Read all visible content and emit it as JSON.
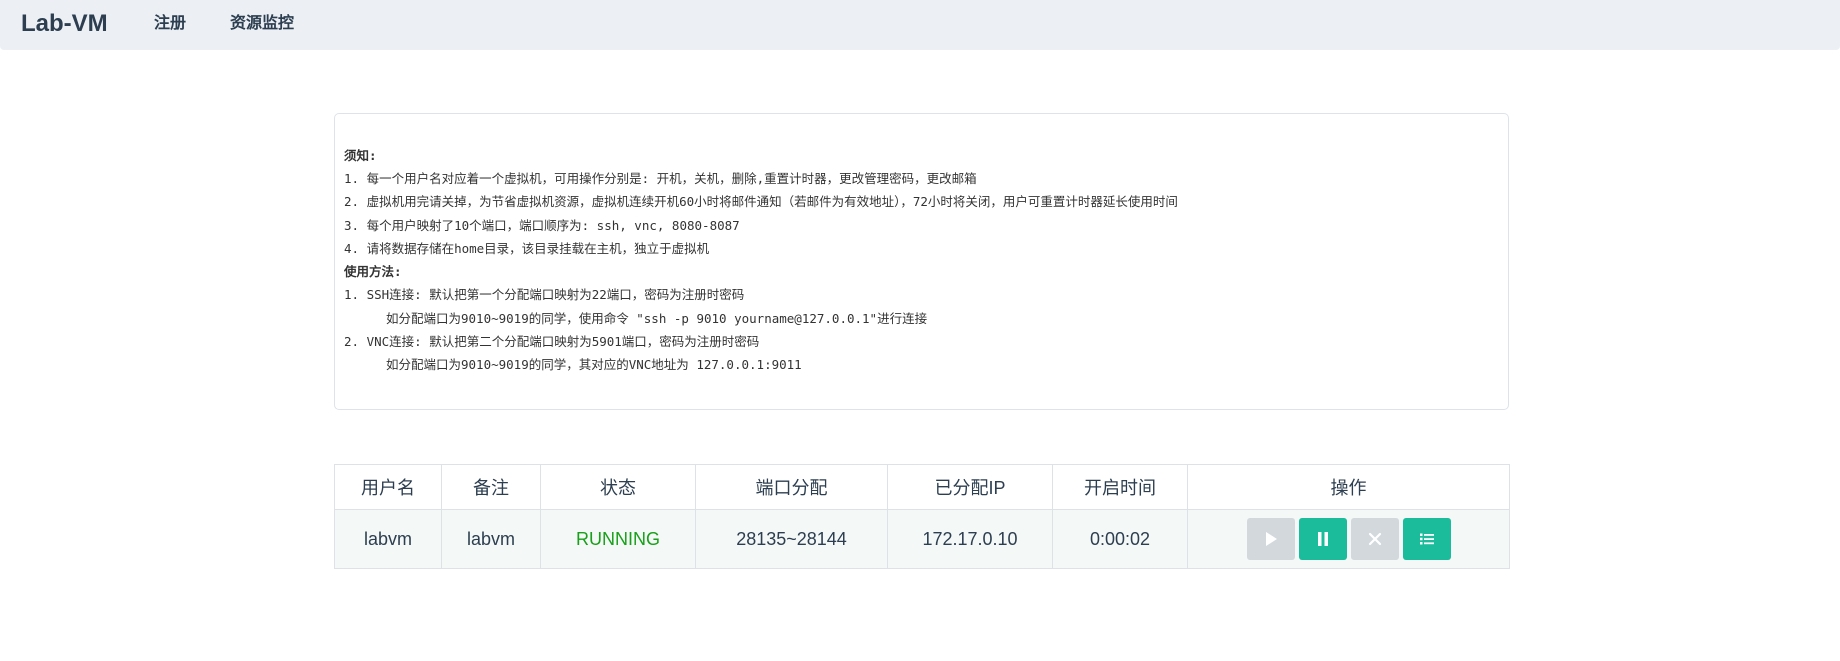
{
  "navbar": {
    "brand": "Lab-VM",
    "links": [
      "注册",
      "资源监控"
    ]
  },
  "notice": {
    "lines": [
      {
        "text": "须知:",
        "style": "bold"
      },
      {
        "text": "1. 每一个用户名对应着一个虚拟机，可用操作分别是: 开机，关机，删除,重置计时器，更改管理密码，更改邮箱",
        "style": "normal"
      },
      {
        "text": "2. 虚拟机用完请关掉，为节省虚拟机资源，虚拟机连续开机60小时将邮件通知（若邮件为有效地址），72小时将关闭，用户可重置计时器延长使用时间",
        "style": "normal"
      },
      {
        "text": "3. 每个用户映射了10个端口，端口顺序为: ssh, vnc, 8080-8087",
        "style": "normal"
      },
      {
        "text": "4. 请将数据存储在home目录，该目录挂载在主机，独立于虚拟机",
        "style": "normal"
      },
      {
        "text": "使用方法:",
        "style": "bold"
      },
      {
        "text": "1. SSH连接: 默认把第一个分配端口映射为22端口，密码为注册时密码",
        "style": "normal"
      },
      {
        "text": "如分配端口为9010~9019的同学，使用命令 \"ssh -p 9010 yourname@127.0.0.1\"进行连接",
        "style": "indent"
      },
      {
        "text": "2. VNC连接: 默认把第二个分配端口映射为5901端口，密码为注册时密码",
        "style": "normal"
      },
      {
        "text": "如分配端口为9010~9019的同学，其对应的VNC地址为 127.0.0.1:9011",
        "style": "indent"
      }
    ]
  },
  "table": {
    "headers": [
      "用户名",
      "备注",
      "状态",
      "端口分配",
      "已分配IP",
      "开启时间",
      "操作"
    ],
    "rows": [
      {
        "username": "labvm",
        "note": "labvm",
        "status": "RUNNING",
        "ports": "28135~28144",
        "ip": "172.17.0.10",
        "uptime": "0:00:02"
      }
    ],
    "actions": [
      {
        "icon": "play-icon",
        "state": "disabled"
      },
      {
        "icon": "pause-icon",
        "state": "active"
      },
      {
        "icon": "close-icon",
        "state": "disabled"
      },
      {
        "icon": "list-icon",
        "state": "active"
      }
    ]
  },
  "colors": {
    "navbar_bg": "#ecf0f4",
    "accent": "#1bbc9b",
    "disabled": "#d2d8dc",
    "running": "#18a01a",
    "text": "#2c3e50"
  }
}
